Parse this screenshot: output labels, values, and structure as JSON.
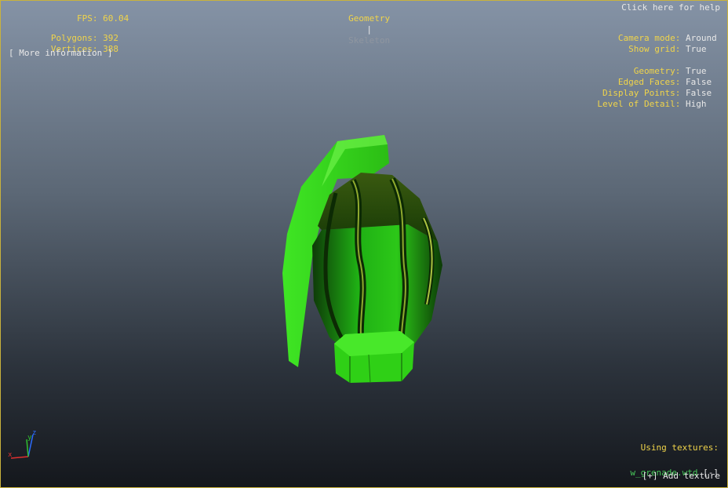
{
  "stats": {
    "fps_label": "FPS:",
    "fps_value": "60.04",
    "polygons_label": "Polygons:",
    "polygons_value": "392",
    "vertices_label": "Vertices:",
    "vertices_value": "388",
    "more_info": "[ More information ]"
  },
  "tabs": {
    "geometry": "Geometry",
    "separator": "|",
    "skeleton": "Skeleton"
  },
  "help_link": "Click here for help",
  "view_settings": [
    {
      "label": "Camera mode:",
      "value": "Around"
    },
    {
      "label": "Show grid:",
      "value": "True"
    },
    {
      "label": "Geometry:",
      "value": "True"
    },
    {
      "label": "Edged Faces:",
      "value": "False"
    },
    {
      "label": "Display Points:",
      "value": "False"
    },
    {
      "label": "Level of Detail:",
      "value": "High"
    }
  ],
  "textures": {
    "heading": "Using textures:",
    "file": "w_grenade.wtd",
    "remove": "[-]",
    "add": "[+] Add texture"
  },
  "axes": {
    "x": "x",
    "y": "y",
    "z": "z"
  },
  "colors": {
    "label": "#f0d44a",
    "value": "#e8e8e8",
    "texture_file": "#48c85a",
    "inactive_tab": "#8f96a0",
    "frame": "#c9b23c",
    "model_green": "#3ee01a"
  }
}
